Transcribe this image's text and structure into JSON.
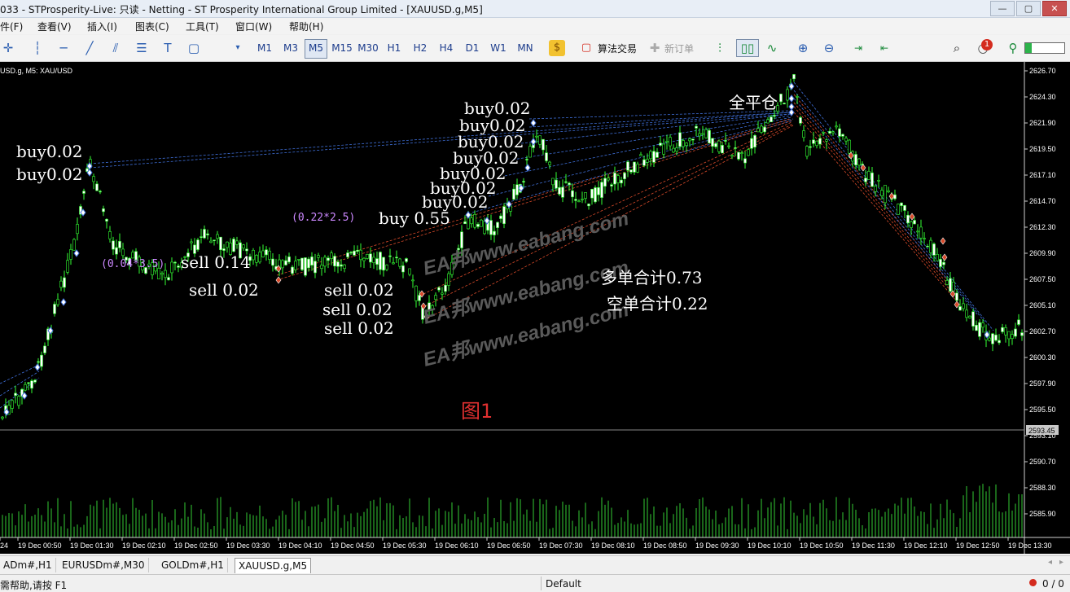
{
  "window": {
    "title": "033 - STProsperity-Live: 只读 - Netting - ST Prosperity International Group Limited - [XAUUSD.g,M5]",
    "controls": [
      "—",
      "▢",
      "✕"
    ]
  },
  "menu": {
    "items": [
      "件(F)",
      "查看(V)",
      "插入(I)",
      "图表(C)",
      "工具(T)",
      "窗口(W)",
      "帮助(H)"
    ]
  },
  "toolbar": {
    "timeframes": [
      "M1",
      "M3",
      "M5",
      "M15",
      "M30",
      "H1",
      "H2",
      "H4",
      "D1",
      "W1",
      "MN"
    ],
    "active_timeframe": "M5",
    "algo_trading_label": "算法交易",
    "new_order_label": "新订单",
    "notification_count": "1"
  },
  "chart": {
    "symbol_header": "USD.g, M5: XAU/USD",
    "price_ticks": [
      "2626.70",
      "2624.30",
      "2621.90",
      "2619.50",
      "2617.10",
      "2614.70",
      "2612.30",
      "2609.90",
      "2607.50",
      "2605.10",
      "2602.70",
      "2600.30",
      "2597.90",
      "2595.50",
      "2593.10",
      "2590.70",
      "2588.30",
      "2585.90"
    ],
    "current_price": "2593.45",
    "time_ticks": [
      "24",
      "19 Dec 00:50",
      "19 Dec 01:30",
      "19 Dec 02:10",
      "19 Dec 02:50",
      "19 Dec 03:30",
      "19 Dec 04:10",
      "19 Dec 04:50",
      "19 Dec 05:30",
      "19 Dec 06:10",
      "19 Dec 06:50",
      "19 Dec 07:30",
      "19 Dec 08:10",
      "19 Dec 08:50",
      "19 Dec 09:30",
      "19 Dec 10:10",
      "19 Dec 10:50",
      "19 Dec 11:30",
      "19 Dec 12:10",
      "19 Dec 12:50",
      "19 Dec 13:30"
    ],
    "annotations": {
      "buy_left_1": "buy0.02",
      "buy_left_2": "buy0.02",
      "small_pink_left": "(0.04*3.5)",
      "sell_014": "sell 0.14",
      "sell_002_a": "sell 0.02",
      "small_pink_mid": "(0.22*2.5)",
      "buy_055": "buy 0.55",
      "sell_002_b": "sell 0.02",
      "sell_002_c": "sell 0.02",
      "sell_002_d": "sell 0.02",
      "buy_stack": [
        "buy0.02",
        "buy0.02",
        "buy0.02",
        "buy0.02",
        "buy0.02",
        "buy0.02",
        "buy0.02"
      ],
      "close_all": "全平仓",
      "long_total": "多单合计0.73",
      "short_total": "空单合计0.22",
      "figure_label": "图1"
    },
    "watermarks": [
      "EA邦www.eabang.com",
      "EA邦www.eabang.com",
      "EA邦www.eabang.com"
    ],
    "colors": {
      "bull": "#ffffff",
      "bear": "#000000",
      "wick": "#33ff33",
      "volume": "#33cc33",
      "buy_line": "#3f6fd8",
      "sell_line": "#d84a2a",
      "pink_note": "#cc88ff",
      "figure_label": "#e03030"
    }
  },
  "tabs": {
    "items": [
      "ADm#,H1",
      "EURUSDm#,M30",
      "GOLDm#,H1",
      "XAUUSD.g,M5"
    ],
    "active": "XAUUSD.g,M5"
  },
  "status": {
    "help": "需帮助,请按 F1",
    "profile": "Default",
    "connection": "0 / 0"
  }
}
